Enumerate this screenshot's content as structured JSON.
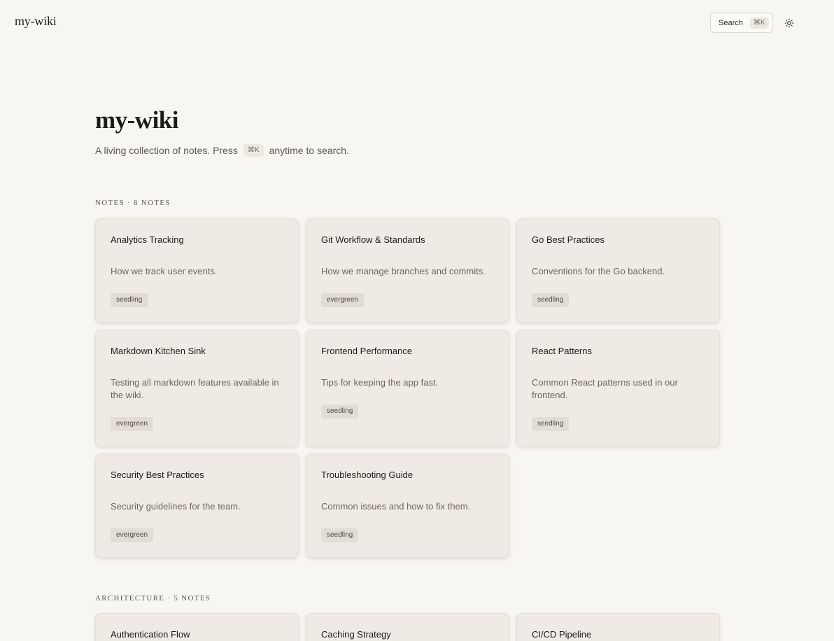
{
  "header": {
    "logo": "my-wiki",
    "search_label": "Search",
    "search_shortcut": "⌘K",
    "theme_icon": "sun-icon"
  },
  "hero": {
    "title": "my-wiki",
    "subtitle_before": "A living collection of notes. Press",
    "shortcut": "⌘K",
    "subtitle_after": "anytime to search."
  },
  "sections": [
    {
      "heading": "NOTES · 8 NOTES",
      "cards": [
        {
          "title": "Analytics Tracking",
          "desc": "How we track user events.",
          "tag": "seedling"
        },
        {
          "title": "Git Workflow & Standards",
          "desc": "How we manage branches and commits.",
          "tag": "evergreen"
        },
        {
          "title": "Go Best Practices",
          "desc": "Conventions for the Go backend.",
          "tag": "seedling"
        },
        {
          "title": "Markdown Kitchen Sink",
          "desc": "Testing all markdown features available in the wiki.",
          "tag": "evergreen"
        },
        {
          "title": "Frontend Performance",
          "desc": "Tips for keeping the app fast.",
          "tag": "seedling"
        },
        {
          "title": "React Patterns",
          "desc": "Common React patterns used in our frontend.",
          "tag": "seedling"
        },
        {
          "title": "Security Best Practices",
          "desc": "Security guidelines for the team.",
          "tag": "evergreen"
        },
        {
          "title": "Troubleshooting Guide",
          "desc": "Common issues and how to fix them.",
          "tag": "seedling"
        }
      ]
    },
    {
      "heading": "ARCHITECTURE · 5 NOTES",
      "cards": [
        {
          "title": "Authentication Flow"
        },
        {
          "title": "Caching Strategy"
        },
        {
          "title": "CI/CD Pipeline"
        }
      ]
    }
  ]
}
